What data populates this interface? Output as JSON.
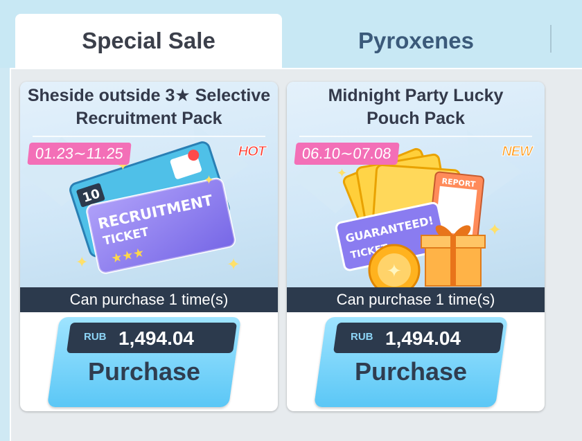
{
  "tabs": [
    {
      "label": "Special Sale",
      "active": true
    },
    {
      "label": "Pyroxenes",
      "active": false
    }
  ],
  "products": [
    {
      "title_line1": "Sheside outside 3★ Selective",
      "title_line2": "Recruitment Pack",
      "date_range": "01.23∼11.25",
      "tag": "HOT",
      "ticket_count": "10",
      "ticket_text1": "RECRUITMENT",
      "ticket_text2": "TICKET",
      "limit_text": "Can purchase 1 time(s)",
      "currency": "RUB",
      "price": "1,494.04",
      "button_label": "Purchase"
    },
    {
      "title_line1": "Midnight Party Lucky",
      "title_line2": "Pouch Pack",
      "date_range": "06.10∼07.08",
      "tag": "NEW",
      "ticket_text1": "GUARANTEED!",
      "ticket_text2": "TICKET",
      "report_text": "REPORT",
      "limit_text": "Can purchase 1 time(s)",
      "currency": "RUB",
      "price": "1,494.04",
      "button_label": "Purchase"
    }
  ],
  "colors": {
    "accent_pink": "#f36fb7",
    "strip_dark": "#2c3a4d",
    "button_blue": "#5bc7f6"
  }
}
